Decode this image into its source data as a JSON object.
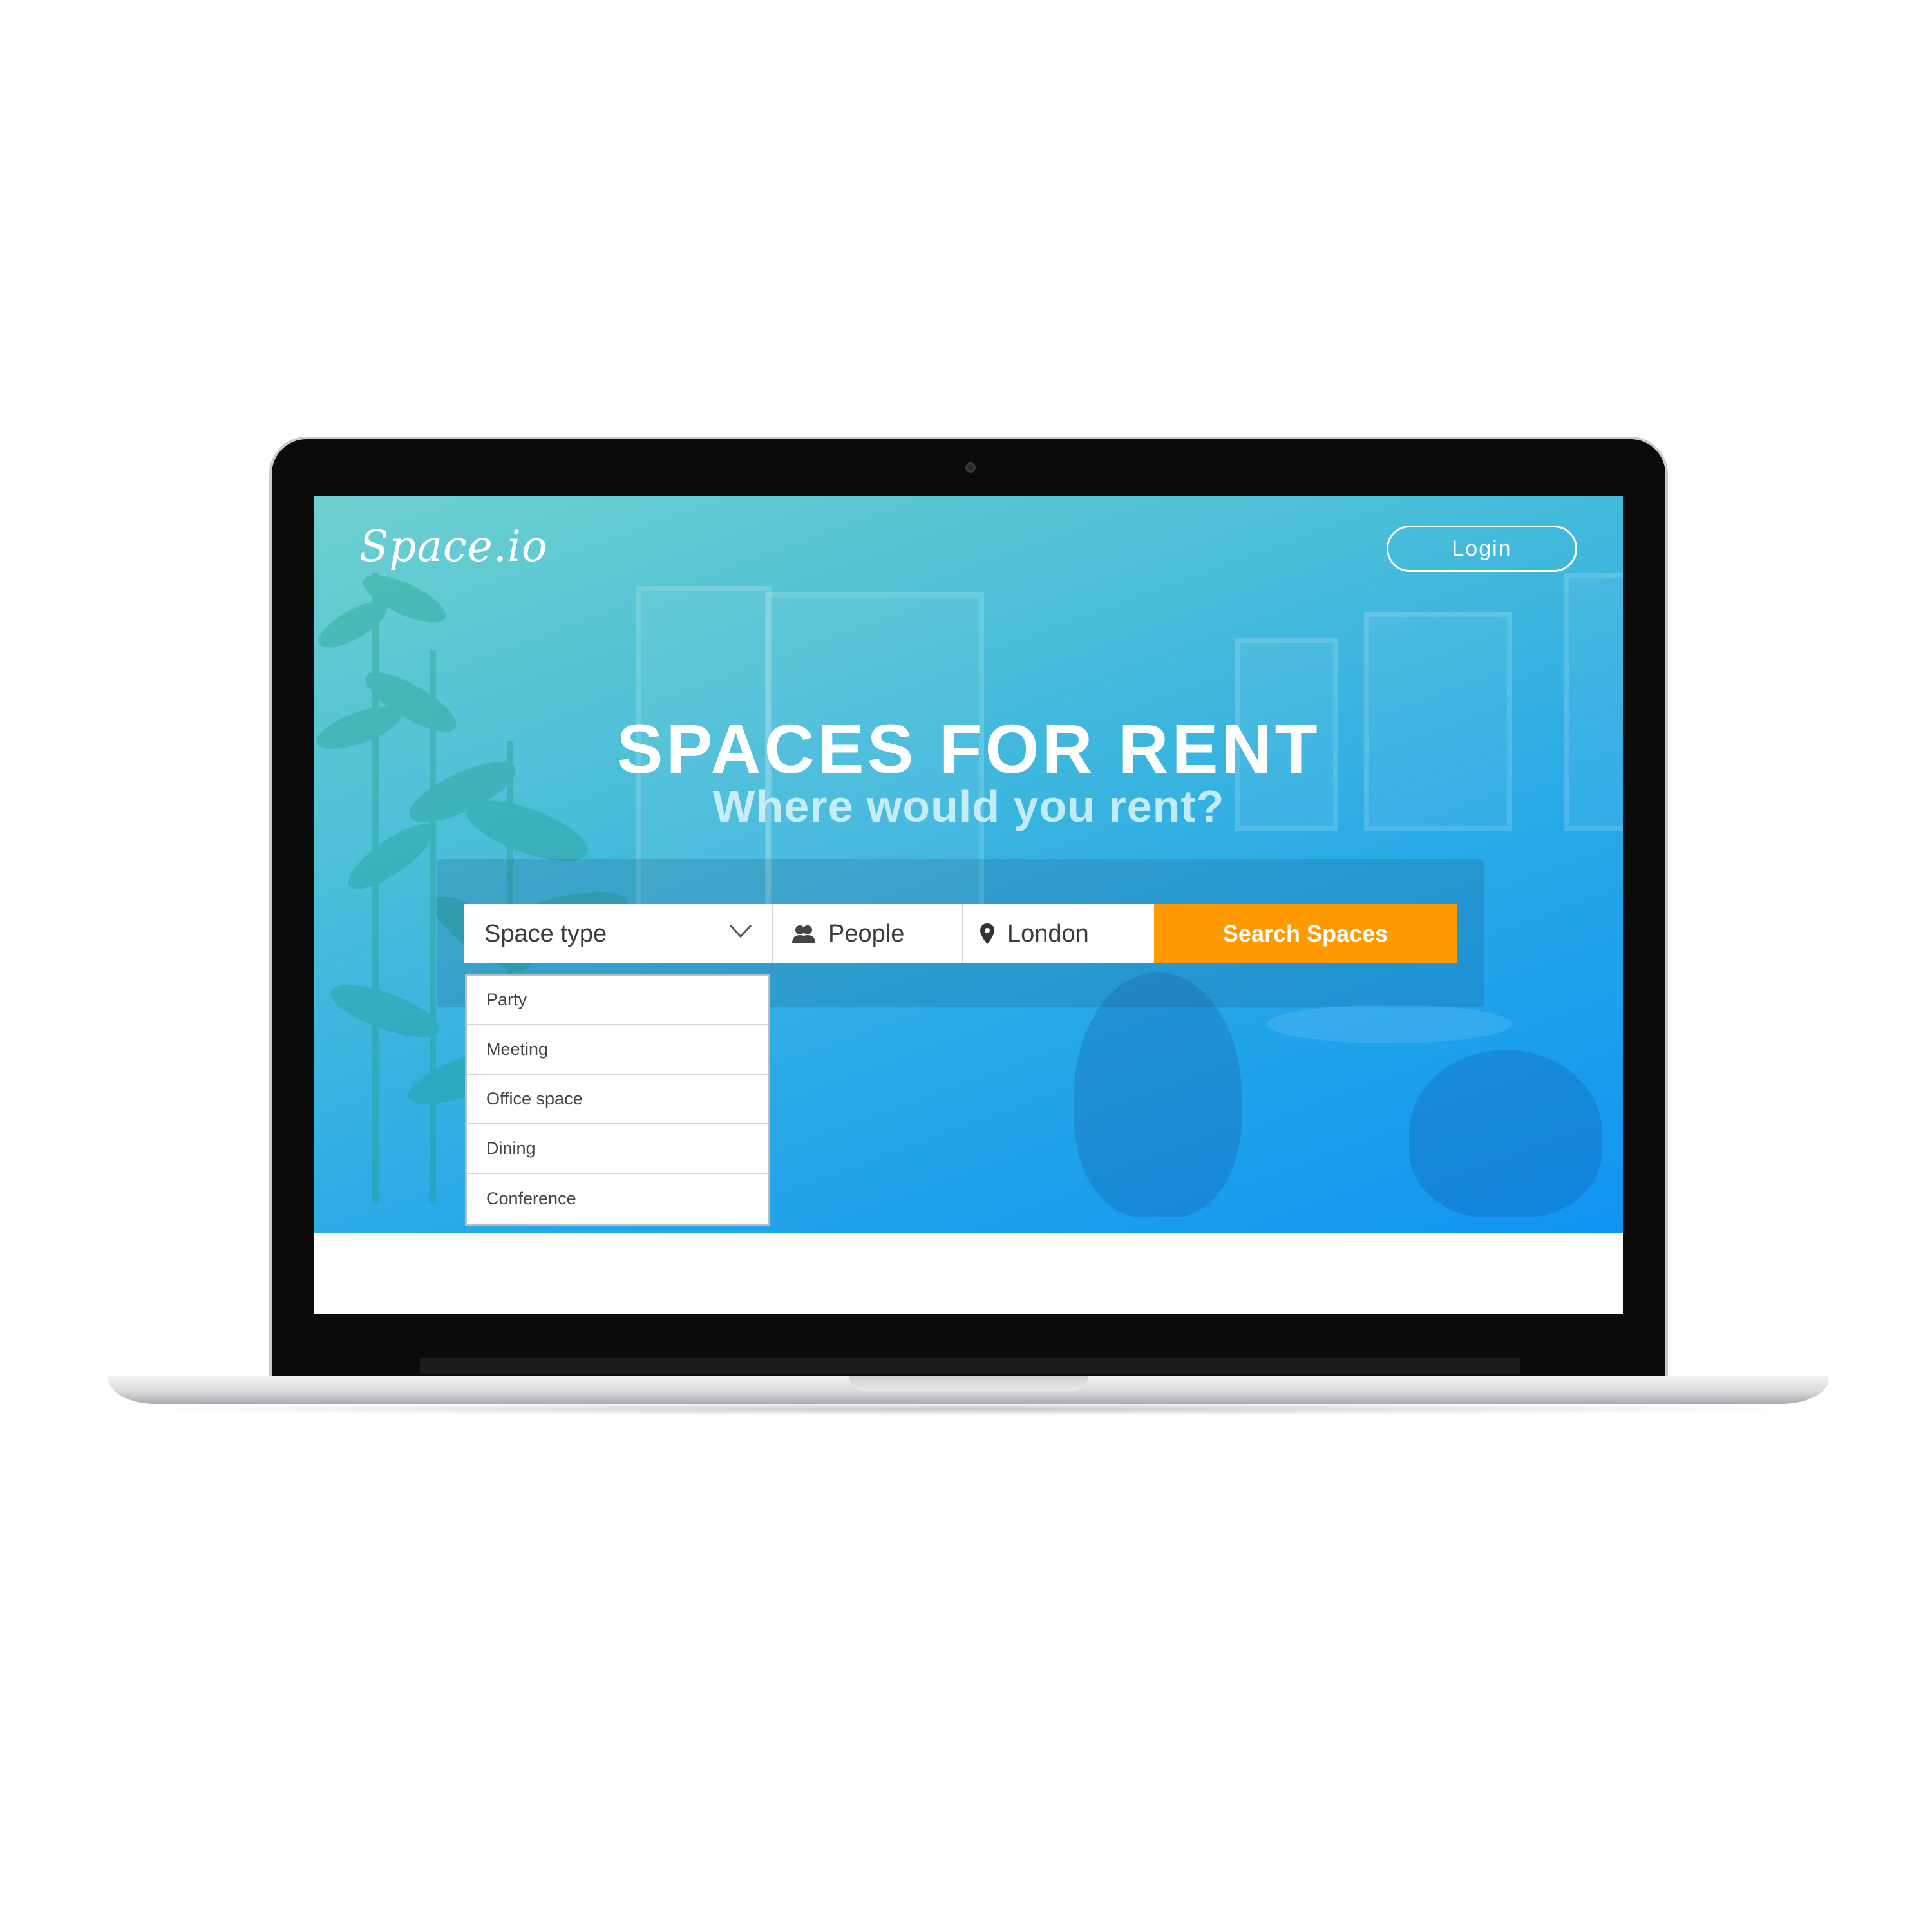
{
  "brand": {
    "logo_text": "Space.io"
  },
  "header": {
    "login_label": "Login"
  },
  "hero": {
    "title": "SPACES FOR RENT",
    "subtitle": "Where would you rent?"
  },
  "search": {
    "space_type_label": "Space type",
    "people_label": "People",
    "location_value": "London",
    "button_label": "Search Spaces",
    "dropdown_options": [
      "Party",
      "Meeting",
      "Office space",
      "Dining",
      "Conference"
    ]
  },
  "colors": {
    "accent": "#ff9a00",
    "hero_gradient_start": "#6ed0cf",
    "hero_gradient_end": "#0f94f2"
  },
  "icons": {
    "space_type": "chevron-down-icon",
    "people": "people-icon",
    "location": "location-pin-icon"
  }
}
